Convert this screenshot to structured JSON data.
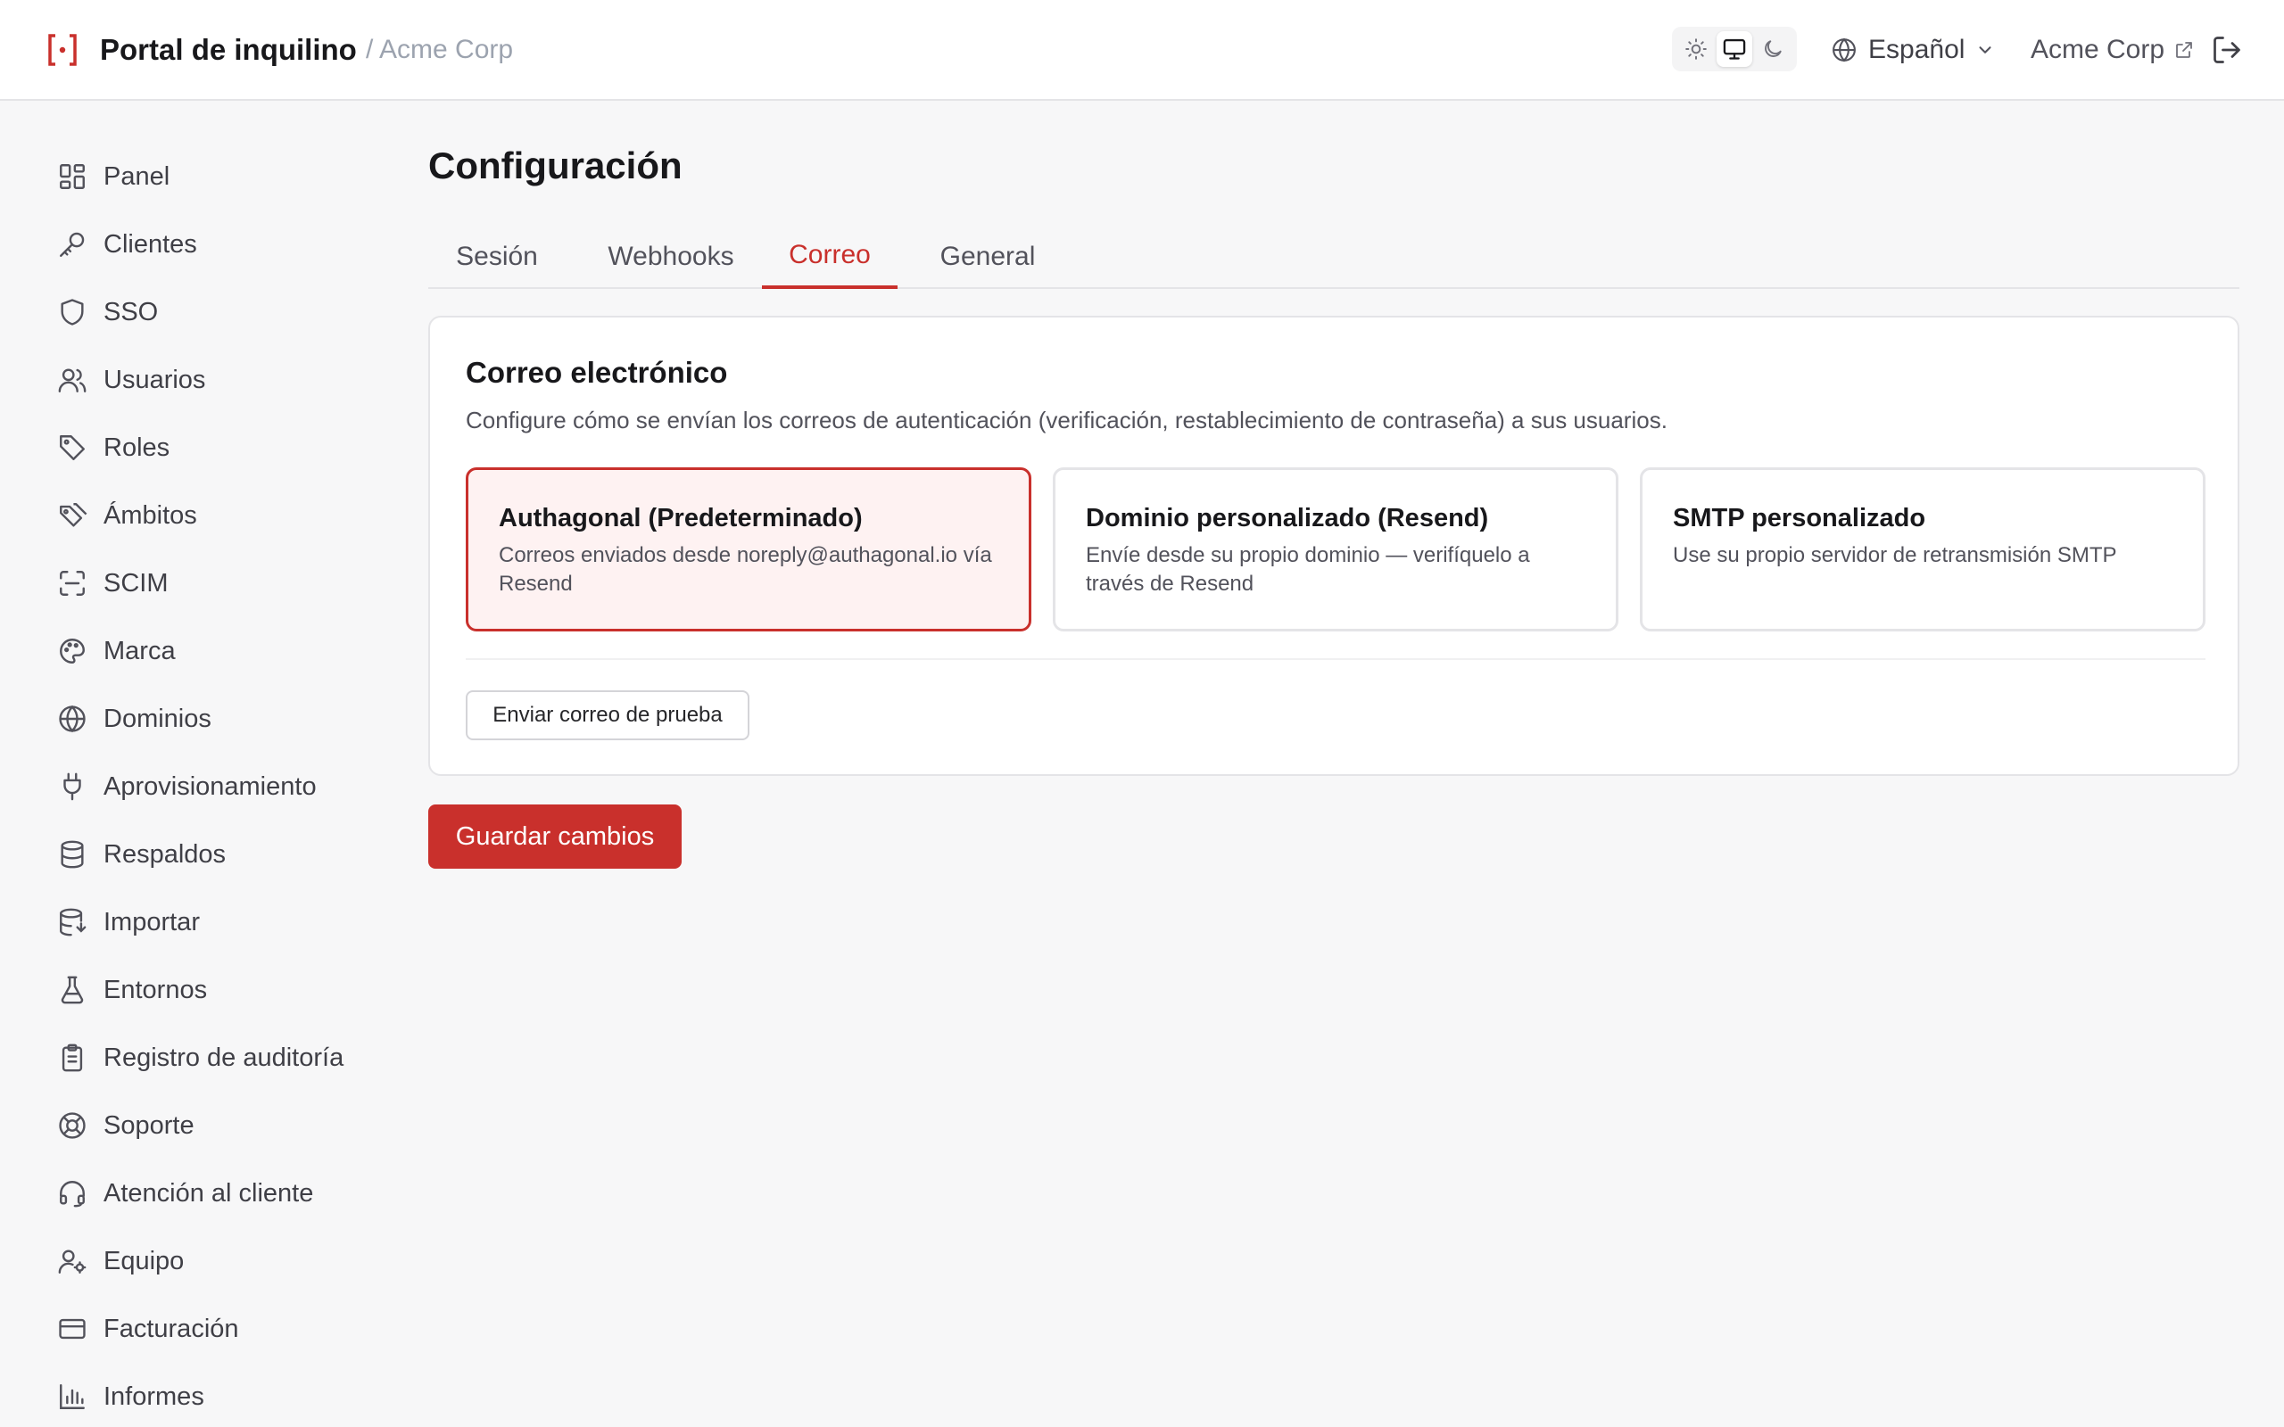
{
  "header": {
    "brand": "Portal de inquilino",
    "tenant_crumb": "/ Acme Corp",
    "language": "Español",
    "tenant_link": "Acme Corp",
    "theme_options": [
      "light",
      "system",
      "dark"
    ],
    "theme_selected": "system"
  },
  "sidebar": {
    "items": [
      {
        "label": "Panel",
        "icon": "grid-icon"
      },
      {
        "label": "Clientes",
        "icon": "key-icon"
      },
      {
        "label": "SSO",
        "icon": "shield-icon"
      },
      {
        "label": "Usuarios",
        "icon": "users-icon"
      },
      {
        "label": "Roles",
        "icon": "tag-icon"
      },
      {
        "label": "Ámbitos",
        "icon": "tags-icon"
      },
      {
        "label": "SCIM",
        "icon": "scan-icon"
      },
      {
        "label": "Marca",
        "icon": "palette-icon"
      },
      {
        "label": "Dominios",
        "icon": "globe-icon"
      },
      {
        "label": "Aprovisionamiento",
        "icon": "plug-icon"
      },
      {
        "label": "Respaldos",
        "icon": "database-icon"
      },
      {
        "label": "Importar",
        "icon": "database-import-icon"
      },
      {
        "label": "Entornos",
        "icon": "flask-icon"
      },
      {
        "label": "Registro de auditoría",
        "icon": "clipboard-icon"
      },
      {
        "label": "Soporte",
        "icon": "lifebuoy-icon"
      },
      {
        "label": "Atención al cliente",
        "icon": "headset-icon"
      },
      {
        "label": "Equipo",
        "icon": "user-cog-icon"
      },
      {
        "label": "Facturación",
        "icon": "credit-card-icon"
      },
      {
        "label": "Informes",
        "icon": "bar-chart-icon"
      }
    ]
  },
  "main": {
    "title": "Configuración",
    "tabs": [
      {
        "label": "Sesión"
      },
      {
        "label": "Webhooks"
      },
      {
        "label": "Correo",
        "active": true
      },
      {
        "label": "General"
      }
    ],
    "card": {
      "title": "Correo electrónico",
      "description": "Configure cómo se envían los correos de autenticación (verificación, restablecimiento de contraseña) a sus usuarios.",
      "options": [
        {
          "title": "Authagonal (Predeterminado)",
          "desc": "Correos enviados desde noreply@authagonal.io vía Resend",
          "selected": true
        },
        {
          "title": "Dominio personalizado (Resend)",
          "desc": "Envíe desde su propio dominio — verifíquelo a través de Resend"
        },
        {
          "title": "SMTP personalizado",
          "desc": "Use su propio servidor de retransmisión SMTP"
        }
      ],
      "test_button": "Enviar correo de prueba"
    },
    "save_button": "Guardar cambios"
  },
  "colors": {
    "accent": "#c9302c",
    "selected_bg": "#fef2f2"
  }
}
